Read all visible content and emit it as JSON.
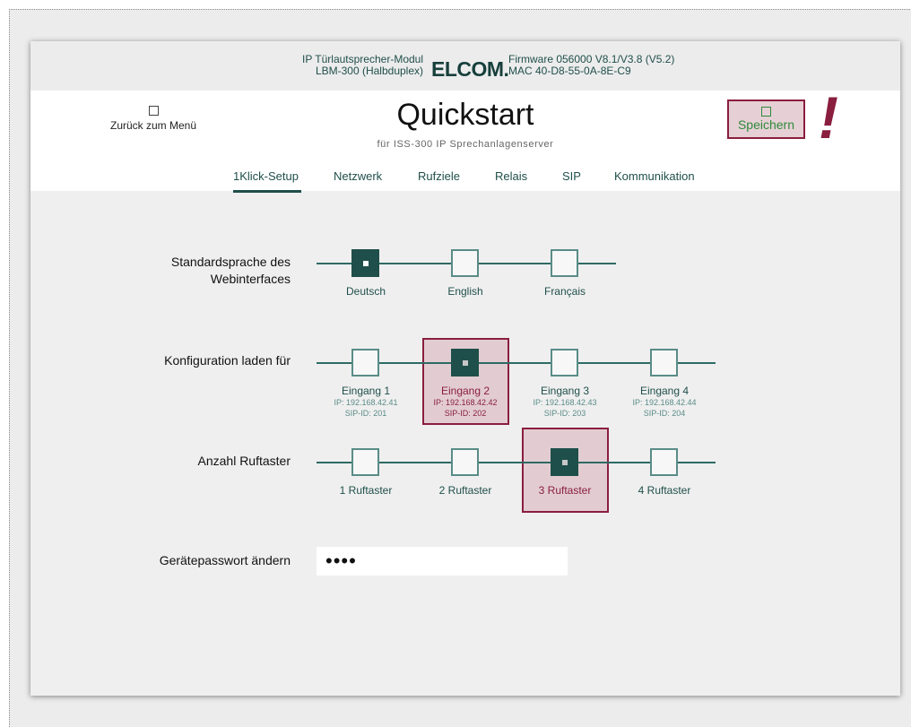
{
  "device": {
    "model_line1": "IP Türlautsprecher-Modul",
    "model_line2": "LBM-300 (Halbduplex)",
    "logo": "ELCOM.",
    "firmware": "Firmware 056000 V8.1/V3.8 (V5.2)",
    "mac": "MAC 40-D8-55-0A-8E-C9"
  },
  "header": {
    "back_label": "Zurück zum Menü",
    "title": "Quickstart",
    "subtitle": "für ISS-300 IP Sprechanlagenserver",
    "save_label": "Speichern",
    "alert_mark": "!"
  },
  "tabs": [
    {
      "label": "1Klick-Setup",
      "active": true
    },
    {
      "label": "Netzwerk",
      "active": false
    },
    {
      "label": "Rufziele",
      "active": false
    },
    {
      "label": "Relais",
      "active": false
    },
    {
      "label": "SIP",
      "active": false
    },
    {
      "label": "Kommunikation",
      "active": false
    }
  ],
  "language": {
    "label_line1": "Standardsprache des",
    "label_line2": "Webinterfaces",
    "options": [
      {
        "label": "Deutsch",
        "selected": true
      },
      {
        "label": "English",
        "selected": false
      },
      {
        "label": "Français",
        "selected": false
      }
    ]
  },
  "config": {
    "label": "Konfiguration laden für",
    "options": [
      {
        "label": "Eingang 1",
        "ip": "IP: 192.168.42.41",
        "sip": "SIP-ID: 201",
        "selected": false
      },
      {
        "label": "Eingang 2",
        "ip": "IP: 192.168.42.42",
        "sip": "SIP-ID: 202",
        "selected": true
      },
      {
        "label": "Eingang 3",
        "ip": "IP: 192.168.42.43",
        "sip": "SIP-ID: 203",
        "selected": false
      },
      {
        "label": "Eingang 4",
        "ip": "IP: 192.168.42.44",
        "sip": "SIP-ID: 204",
        "selected": false
      }
    ]
  },
  "buttons": {
    "label": "Anzahl Ruftaster",
    "options": [
      {
        "label": "1 Ruftaster",
        "selected": false
      },
      {
        "label": "2 Ruftaster",
        "selected": false
      },
      {
        "label": "3 Ruftaster",
        "selected": true
      },
      {
        "label": "4 Ruftaster",
        "selected": false
      }
    ]
  },
  "password": {
    "label": "Gerätepasswort ändern",
    "value": "••••"
  },
  "colors": {
    "accent": "#1f4f4a",
    "highlight": "#8a1e3f",
    "save_green": "#2f8a3c"
  }
}
